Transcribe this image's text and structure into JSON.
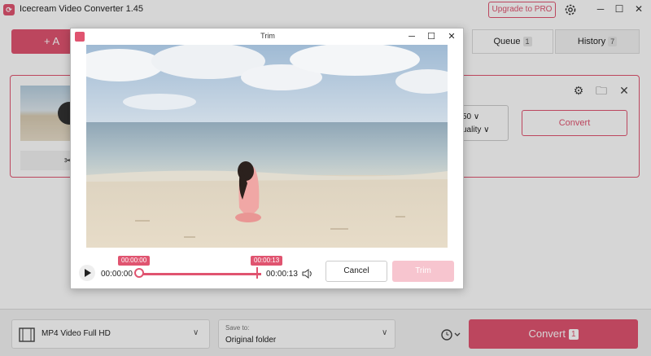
{
  "app": {
    "title": "Icecream Video Converter 1.45",
    "upgrade_label": "Upgrade to PRO",
    "add_label": "+ A",
    "accent_color": "#e05470"
  },
  "tabs": [
    {
      "label": "Queue",
      "count": "1"
    },
    {
      "label": "History",
      "count": "7"
    }
  ],
  "file_card": {
    "format_line1": "50 ∨",
    "format_line2": "uality ∨",
    "convert_label": "Convert"
  },
  "bottom_bar": {
    "preset_label": "MP4 Video Full HD",
    "save_to_label": "Save to:",
    "save_to_value": "Original folder",
    "convert_label": "Convert",
    "convert_count": "1"
  },
  "trim_dialog": {
    "title": "Trim",
    "start_tooltip": "00:00:00",
    "end_tooltip": "00:00:13",
    "start_time": "00:00:00",
    "end_time": "00:00:13",
    "cancel_label": "Cancel",
    "trim_label": "Trim"
  }
}
